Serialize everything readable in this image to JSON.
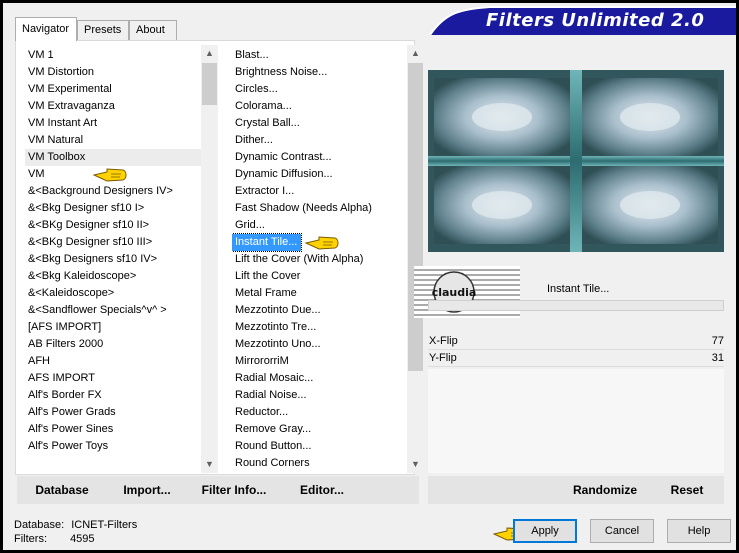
{
  "banner": {
    "title": "Filters Unlimited 2.0"
  },
  "tabs": [
    {
      "label": "Navigator"
    },
    {
      "label": "Presets"
    },
    {
      "label": "About"
    }
  ],
  "categories": [
    "VM 1",
    "VM Distortion",
    "VM Experimental",
    "VM Extravaganza",
    "VM Instant Art",
    "VM Natural",
    "VM Toolbox",
    "VM",
    "&<Background Designers IV>",
    "&<Bkg Designer sf10 I>",
    "&<BKg Designer sf10 II>",
    "&<BKg Designer sf10 III>",
    "&<Bkg Designers sf10 IV>",
    "&<Bkg Kaleidoscope>",
    "&<Kaleidoscope>",
    "&<Sandflower Specials^v^ >",
    "[AFS IMPORT]",
    "AB Filters 2000",
    "AFH",
    "AFS IMPORT",
    "Alf's Border FX",
    "Alf's Power Grads",
    "Alf's Power Sines",
    "Alf's Power Toys"
  ],
  "filters": [
    "Blast...",
    "Brightness Noise...",
    "Circles...",
    "Colorama...",
    "Crystal Ball...",
    "Dither...",
    "Dynamic Contrast...",
    "Dynamic Diffusion...",
    "Extractor I...",
    "Fast Shadow (Needs Alpha)",
    "Grid...",
    "Instant Tile...",
    "Lift the Cover (With Alpha)",
    "Lift the Cover",
    "Metal Frame",
    "Mezzotinto Due...",
    "Mezzotinto Tre...",
    "Mezzotinto Uno...",
    "MirrororriM",
    "Radial Mosaic...",
    "Radial Noise...",
    "Reductor...",
    "Remove Gray...",
    "Round Button...",
    "Round Corners"
  ],
  "selected_filter": "Instant Tile...",
  "logo_text": "claudia",
  "params": [
    {
      "label": "X-Flip",
      "value": "77"
    },
    {
      "label": "Y-Flip",
      "value": "31"
    }
  ],
  "bottom_buttons": {
    "database": "Database",
    "import": "Import...",
    "filter_info": "Filter Info...",
    "editor": "Editor...",
    "randomize": "Randomize",
    "reset": "Reset"
  },
  "status": {
    "database_label": "Database:",
    "database_value": "ICNET-Filters",
    "filters_label": "Filters:",
    "filters_value": "4595"
  },
  "dialog_buttons": {
    "apply": "Apply",
    "cancel": "Cancel",
    "help": "Help"
  },
  "colors": {
    "banner": "#1a1a9e",
    "selection": "#3399ff",
    "hand": "#ffd200",
    "preview": "#2f4f55"
  }
}
